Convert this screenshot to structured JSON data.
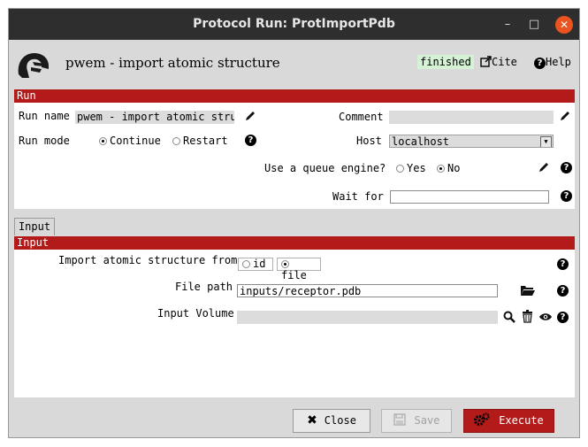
{
  "window": {
    "title": "Protocol Run: ProtImportPdb",
    "minimize_glyph": "–",
    "maximize_glyph": "□",
    "close_glyph": "✕"
  },
  "header": {
    "protocol_title": "pwem - import atomic structure",
    "status": "finished",
    "cite_label": "Cite",
    "help_label": "Help",
    "logo_icon": "scipion-helmet-logo"
  },
  "run_section": {
    "title": "Run",
    "run_name_label": "Run name",
    "run_name_value": "pwem - import atomic structure",
    "comment_label": "Comment",
    "comment_value": "",
    "run_mode_label": "Run mode",
    "mode_continue": "Continue",
    "mode_restart": "Restart",
    "host_label": "Host",
    "host_value": "localhost",
    "queue_label": "Use a queue engine?",
    "queue_yes": "Yes",
    "queue_no": "No",
    "wait_label": "Wait for",
    "wait_value": ""
  },
  "tabs": [
    "Input"
  ],
  "input_section": {
    "title": "Input",
    "import_from_label": "Import atomic structure from",
    "import_id": "id",
    "import_file": "file",
    "file_path_label": "File path",
    "file_path_value": "inputs/receptor.pdb",
    "input_volume_label": "Input Volume",
    "input_volume_value": ""
  },
  "footer": {
    "close_label": "Close",
    "save_label": "Save",
    "execute_label": "Execute"
  },
  "colors": {
    "section_bar": "#b31b1b",
    "status_bg": "#d5f2d5",
    "execute_bg": "#b31b1b",
    "titlebar": "#2e2e2e"
  }
}
